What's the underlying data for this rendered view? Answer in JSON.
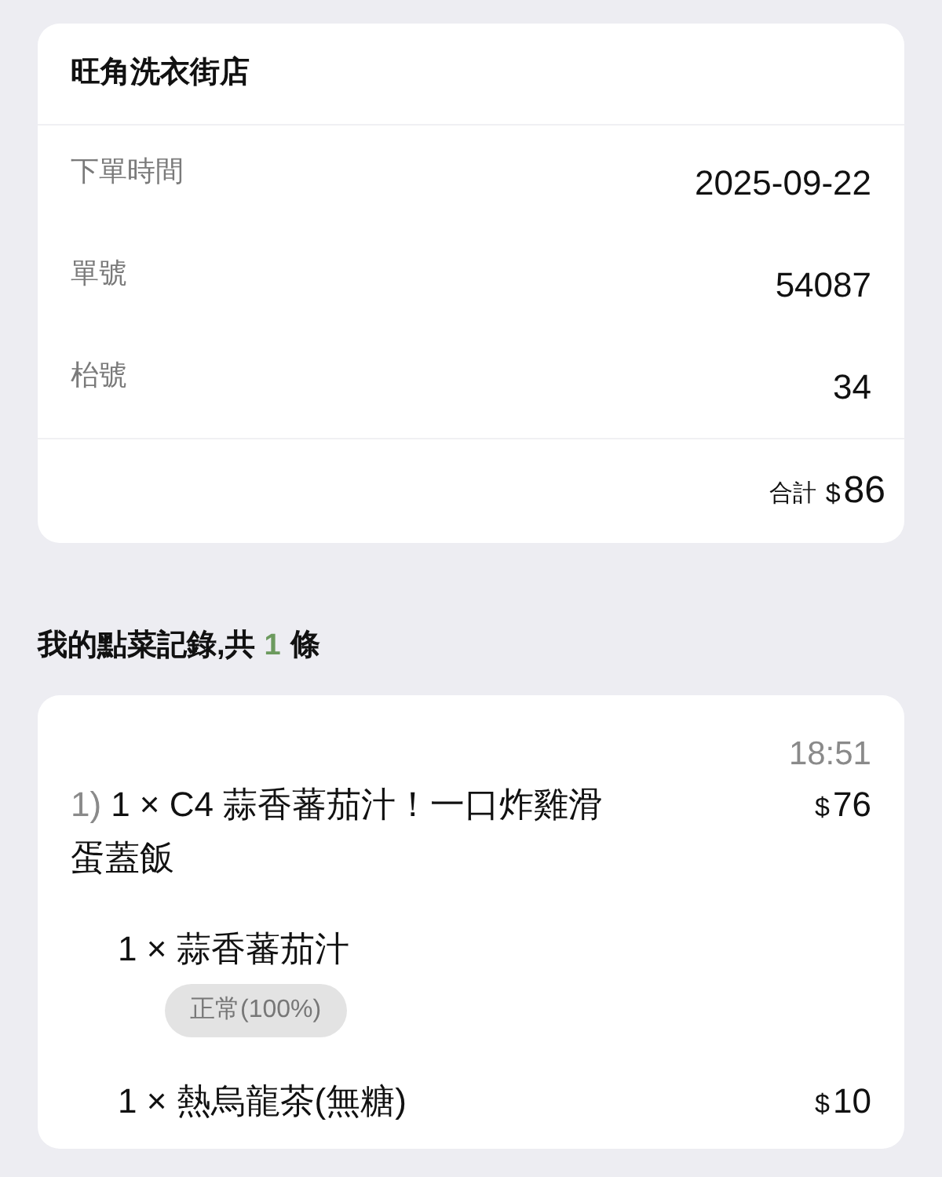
{
  "store": {
    "name": "旺角洗衣街店",
    "details": [
      {
        "label": "下單時間",
        "value": "2025-09-22"
      },
      {
        "label": "單號",
        "value": "54087"
      },
      {
        "label": "枱號",
        "value": "34"
      }
    ],
    "total": {
      "label": "合計",
      "currency": "$",
      "amount": "86"
    }
  },
  "history": {
    "title_prefix": "我的點菜記錄,共",
    "count": "1",
    "title_suffix": "條",
    "orders": [
      {
        "time": "18:51",
        "index": "1)",
        "name": "1 × C4 蒜香蕃茄汁！一口炸雞滑蛋蓋飯",
        "price": {
          "currency": "$",
          "amount": "76"
        },
        "options": [
          {
            "name": "1 × 蒜香蕃茄汁",
            "tags": [
              "正常(100%)"
            ]
          },
          {
            "name": "1 × 熱烏龍茶(無糖)",
            "price": {
              "currency": "$",
              "amount": "10"
            }
          }
        ]
      }
    ]
  }
}
